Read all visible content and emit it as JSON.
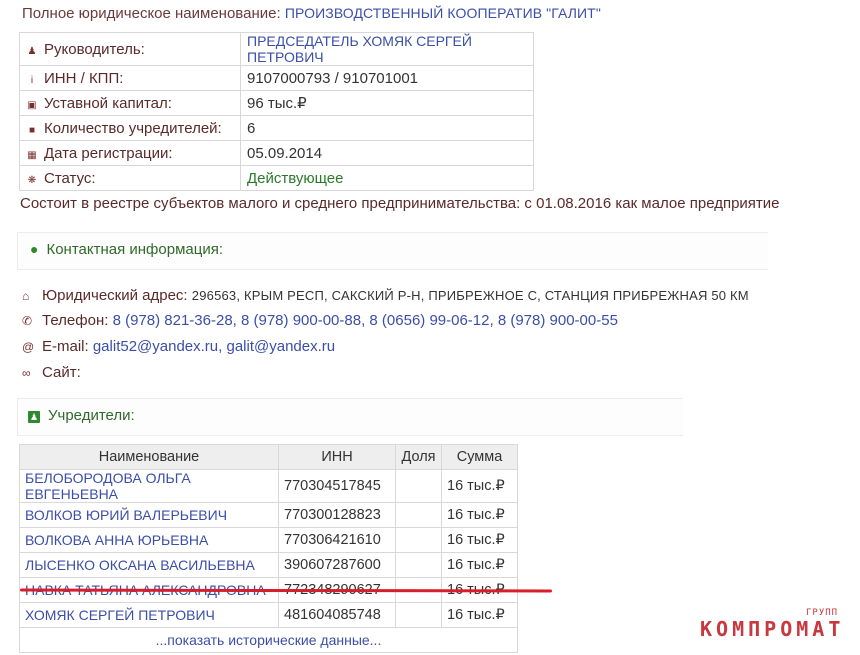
{
  "company": {
    "full_name_label": "Полное юридическое наименование:",
    "full_name_value": "ПРОИЗВОДСТВЕННЫЙ КООПЕРАТИВ \"ГАЛИТ\""
  },
  "info_rows": [
    {
      "icon": "person-icon",
      "label": "Руководитель:",
      "value": "ПРЕДСЕДАТЕЛЬ ХОМЯК СЕРГЕЙ ПЕТРОВИЧ"
    },
    {
      "icon": "info-icon",
      "label": "ИНН / КПП:",
      "value": "9107000793 / 910701001"
    },
    {
      "icon": "money-icon",
      "label": "Уставной капитал:",
      "value": "96 тыс.₽"
    },
    {
      "icon": "founders-icon",
      "label": "Количество учредителей:",
      "value": "6"
    },
    {
      "icon": "calendar-icon",
      "label": "Дата регистрации:",
      "value": "05.09.2014"
    },
    {
      "icon": "status-icon",
      "label": "Статус:",
      "value": "Действующее"
    }
  ],
  "sme_note": "Состоит в реестре субъектов малого и среднего предпринимательства: с 01.08.2016 как малое предприятие",
  "contact": {
    "title": "Контактная информация:",
    "address_label": "Юридический адрес:",
    "address_value": "296563, КРЫМ РЕСП, САКСКИЙ Р-Н, ПРИБРЕЖНОЕ С, СТАНЦИЯ ПРИБРЕЖНАЯ 50 КМ",
    "phone_label": "Телефон:",
    "phones": "8 (978) 821-36-28, 8 (978) 900-00-88, 8 (0656) 99-06-12, 8 (978) 900-00-55",
    "email_label": "E-mail:",
    "emails": "galit52@yandex.ru, galit@yandex.ru",
    "site_label": "Сайт:"
  },
  "founders": {
    "title": "Учредители:",
    "headers": {
      "name": "Наименование",
      "inn": "ИНН",
      "share": "Доля",
      "sum": "Сумма"
    },
    "rows": [
      {
        "name": "БЕЛОБОРОДОВА ОЛЬГА ЕВГЕНЬЕВНА",
        "inn": "770304517845",
        "share": "",
        "sum": "16 тыс.₽"
      },
      {
        "name": "ВОЛКОВ ЮРИЙ ВАЛЕРЬЕВИЧ",
        "inn": "770300128823",
        "share": "",
        "sum": "16 тыс.₽"
      },
      {
        "name": "ВОЛКОВА АННА ЮРЬЕВНА",
        "inn": "770306421610",
        "share": "",
        "sum": "16 тыс.₽"
      },
      {
        "name": "ЛЫСЕНКО ОКСАНА ВАСИЛЬЕВНА",
        "inn": "390607287600",
        "share": "",
        "sum": "16 тыс.₽"
      },
      {
        "name": "НАВКА ТАТЬЯНА АЛЕКСАНДРОВНА",
        "inn": "772348290627",
        "share": "",
        "sum": "16 тыс.₽"
      },
      {
        "name": "ХОМЯК СЕРГЕЙ ПЕТРОВИЧ",
        "inn": "481604085748",
        "share": "",
        "sum": "16 тыс.₽"
      }
    ],
    "show_history": "...показать исторические данные..."
  },
  "watermark": {
    "main": "КОМПРОМАТ",
    "small": "ГРУПП"
  },
  "colors": {
    "link": "#3b4ea8",
    "text": "#5a2a2a",
    "active_status": "#2b7a2b",
    "highlight_line": "#d81e2a"
  }
}
